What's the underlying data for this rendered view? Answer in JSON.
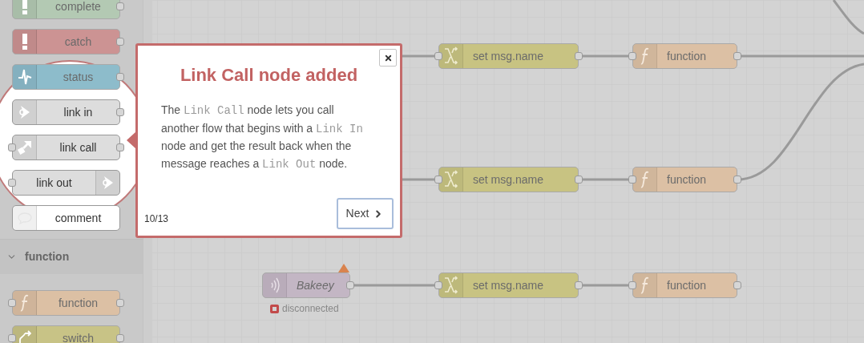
{
  "palette": {
    "sections": [
      {
        "nodes": [
          {
            "label": "complete",
            "kind": "complete",
            "spotlight": false
          },
          {
            "label": "catch",
            "kind": "catch",
            "spotlight": false
          },
          {
            "label": "status",
            "kind": "status",
            "spotlight": false
          },
          {
            "label": "link in",
            "kind": "link-in",
            "spotlight": true
          },
          {
            "label": "link call",
            "kind": "link-call",
            "spotlight": true
          },
          {
            "label": "link out",
            "kind": "link-out",
            "spotlight": true
          },
          {
            "label": "comment",
            "kind": "comment",
            "spotlight": true
          }
        ]
      },
      {
        "title": "function",
        "expanded": true,
        "nodes": [
          {
            "label": "function",
            "kind": "function",
            "spotlight": false
          },
          {
            "label": "switch",
            "kind": "switch",
            "spotlight": false
          }
        ]
      }
    ]
  },
  "canvas": {
    "flows": [
      {
        "nodes": [
          {
            "label": "set msg.name",
            "kind": "change"
          },
          {
            "label": "function",
            "kind": "function"
          }
        ]
      },
      {
        "nodes": [
          {
            "label": "set msg.name",
            "kind": "change"
          },
          {
            "label": "function",
            "kind": "function"
          }
        ]
      },
      {
        "nodes": [
          {
            "label": "Bakeey",
            "kind": "websocket",
            "changed": true,
            "status": {
              "text": "disconnected"
            }
          },
          {
            "label": "set msg.name",
            "kind": "change"
          },
          {
            "label": "function",
            "kind": "function"
          }
        ]
      }
    ]
  },
  "tour": {
    "title": "Link Call node added",
    "body": [
      {
        "text": "The "
      },
      {
        "text": "Link Call",
        "code": true
      },
      {
        "text": " node lets you call another flow that begins with a "
      },
      {
        "text": "Link In",
        "code": true
      },
      {
        "text": " node and get the result back when the message reaches a "
      },
      {
        "text": "Link Out",
        "code": true
      },
      {
        "text": " node."
      }
    ],
    "counter": "10/13",
    "next_label": "Next"
  }
}
